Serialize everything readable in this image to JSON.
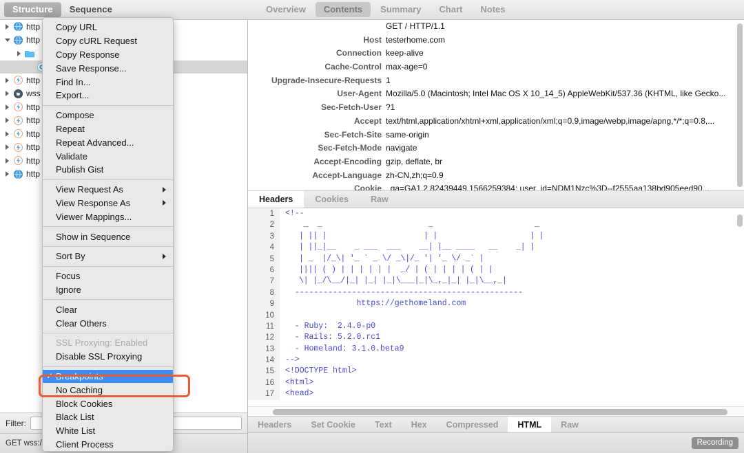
{
  "left": {
    "segments": [
      {
        "label": "Structure",
        "active": true
      },
      {
        "label": "Sequence",
        "active": false
      }
    ],
    "tree": [
      {
        "label": "http",
        "icon": "globe-icon",
        "twisty": "closed",
        "indent": 1
      },
      {
        "label": "http",
        "icon": "globe-icon",
        "twisty": "open",
        "indent": 1
      },
      {
        "label": "",
        "icon": "folder-icon",
        "twisty": "closed",
        "indent": 2
      },
      {
        "label": "",
        "icon": "target-icon",
        "twisty": "none",
        "indent": 3,
        "selected": true
      },
      {
        "label": "http",
        "icon": "bolt-icon",
        "twisty": "closed",
        "indent": 1
      },
      {
        "label": "wss",
        "icon": "socket-icon",
        "twisty": "closed",
        "indent": 1
      },
      {
        "label": "http",
        "icon": "bolt-icon",
        "twisty": "closed",
        "indent": 1
      },
      {
        "label": "http",
        "icon": "bolt-icon",
        "twisty": "closed",
        "indent": 1
      },
      {
        "label": "http",
        "icon": "bolt-icon",
        "twisty": "closed",
        "indent": 1
      },
      {
        "label": "http",
        "icon": "bolt-icon",
        "twisty": "closed",
        "indent": 1
      },
      {
        "label": "http",
        "icon": "bolt-icon",
        "twisty": "closed",
        "indent": 1
      },
      {
        "label": "http",
        "icon": "globe-icon",
        "twisty": "closed",
        "indent": 1
      }
    ],
    "filter": {
      "label": "Filter:",
      "value": "",
      "placeholder": ""
    },
    "status": "GET wss:/"
  },
  "context_menu": {
    "groups": [
      {
        "items": [
          {
            "label": "Copy URL"
          },
          {
            "label": "Copy cURL Request"
          },
          {
            "label": "Copy Response"
          },
          {
            "label": "Save Response..."
          },
          {
            "label": "Find In..."
          },
          {
            "label": "Export..."
          }
        ]
      },
      {
        "items": [
          {
            "label": "Compose"
          },
          {
            "label": "Repeat"
          },
          {
            "label": "Repeat Advanced..."
          },
          {
            "label": "Validate"
          },
          {
            "label": "Publish Gist"
          }
        ]
      },
      {
        "items": [
          {
            "label": "View Request As",
            "submenu": true
          },
          {
            "label": "View Response As",
            "submenu": true
          },
          {
            "label": "Viewer Mappings..."
          }
        ]
      },
      {
        "items": [
          {
            "label": "Show in Sequence"
          }
        ]
      },
      {
        "items": [
          {
            "label": "Sort By",
            "submenu": true
          }
        ]
      },
      {
        "items": [
          {
            "label": "Focus"
          },
          {
            "label": "Ignore"
          }
        ]
      },
      {
        "items": [
          {
            "label": "Clear"
          },
          {
            "label": "Clear Others"
          }
        ]
      },
      {
        "items": [
          {
            "label": "SSL Proxying: Enabled",
            "disabled": true
          },
          {
            "label": "Disable SSL Proxying"
          }
        ]
      },
      {
        "items": [
          {
            "label": "Breakpoints",
            "checked": true,
            "selected": true
          },
          {
            "label": "No Caching"
          },
          {
            "label": "Block Cookies"
          },
          {
            "label": "Black List"
          },
          {
            "label": "White List"
          },
          {
            "label": "Client Process"
          }
        ]
      }
    ]
  },
  "right": {
    "tabs": [
      {
        "label": "Overview",
        "active": false
      },
      {
        "label": "Contents",
        "active": true
      },
      {
        "label": "Summary",
        "active": false
      },
      {
        "label": "Chart",
        "active": false
      },
      {
        "label": "Notes",
        "active": false
      }
    ],
    "headers": [
      {
        "name": "",
        "value": "GET / HTTP/1.1"
      },
      {
        "name": "Host",
        "value": "testerhome.com"
      },
      {
        "name": "Connection",
        "value": "keep-alive"
      },
      {
        "name": "Cache-Control",
        "value": "max-age=0"
      },
      {
        "name": "Upgrade-Insecure-Requests",
        "value": "1"
      },
      {
        "name": "User-Agent",
        "value": "Mozilla/5.0 (Macintosh; Intel Mac OS X 10_14_5) AppleWebKit/537.36 (KHTML, like Gecko..."
      },
      {
        "name": "Sec-Fetch-User",
        "value": "?1"
      },
      {
        "name": "Accept",
        "value": "text/html,application/xhtml+xml,application/xml;q=0.9,image/webp,image/apng,*/*;q=0.8,..."
      },
      {
        "name": "Sec-Fetch-Site",
        "value": "same-origin"
      },
      {
        "name": "Sec-Fetch-Mode",
        "value": "navigate"
      },
      {
        "name": "Accept-Encoding",
        "value": "gzip, deflate, br"
      },
      {
        "name": "Accept-Language",
        "value": "zh-CN,zh;q=0.9"
      },
      {
        "name": "Cookie",
        "value": "_ga=GA1.2.82439449.1566259384; user_id=NDM1Nzc%3D--f2555aa138bd905eed90..."
      }
    ],
    "mid_tabs": [
      {
        "label": "Headers",
        "active": true
      },
      {
        "label": "Cookies",
        "active": false
      },
      {
        "label": "Raw",
        "active": false
      }
    ],
    "code_lines": [
      {
        "n": "1",
        "text": "<!--",
        "style": "comment"
      },
      {
        "n": "2",
        "text": "    _  _                       _                      _",
        "style": "art"
      },
      {
        "n": "3",
        "text": "   | || |                     | |                    | |",
        "style": "art"
      },
      {
        "n": "4",
        "text": "   | ||_|__    _ ___  ___    __| |__ ____   __    _| |",
        "style": "art"
      },
      {
        "n": "5",
        "text": "   | _  |/_\\| '_ ` _ \\/ _\\|/_ '| '_ \\/ _` |",
        "style": "art"
      },
      {
        "n": "6",
        "text": "   |||| ( ) | | | | | |  _/ | ( | | | | ( | |",
        "style": "art"
      },
      {
        "n": "7",
        "text": "   \\| |_/\\__/|_| |_| |_|\\___|_|\\_,_|_| |_|\\__,_|",
        "style": "art"
      },
      {
        "n": "8",
        "text": "  ------------------------------------------------",
        "style": "rule"
      },
      {
        "n": "9",
        "text": "               https://gethomeland.com",
        "style": "link"
      },
      {
        "n": "10",
        "text": "",
        "style": "comment"
      },
      {
        "n": "11",
        "text": "  - Ruby:  2.4.0-p0",
        "style": "comment"
      },
      {
        "n": "12",
        "text": "  - Rails: 5.2.0.rc1",
        "style": "comment"
      },
      {
        "n": "13",
        "text": "  - Homeland: 3.1.0.beta9",
        "style": "comment"
      },
      {
        "n": "14",
        "text": "-->",
        "style": "comment"
      },
      {
        "n": "15",
        "text": "<!DOCTYPE html>",
        "style": "doctype"
      },
      {
        "n": "16",
        "text": "<html>",
        "style": "tag"
      },
      {
        "n": "17",
        "text": "<head>",
        "style": "tag"
      }
    ],
    "bottom_tabs": [
      {
        "label": "Headers",
        "active": false
      },
      {
        "label": "Set Cookie",
        "active": false
      },
      {
        "label": "Text",
        "active": false
      },
      {
        "label": "Hex",
        "active": false
      },
      {
        "label": "Compressed",
        "active": false
      },
      {
        "label": "HTML",
        "active": true
      },
      {
        "label": "Raw",
        "active": false
      }
    ],
    "recording_badge": "Recording"
  },
  "colors": {
    "selection_blue": "#3b8cf5",
    "annotation_red": "#ea5a33",
    "code_blue": "#4a4ad6"
  }
}
